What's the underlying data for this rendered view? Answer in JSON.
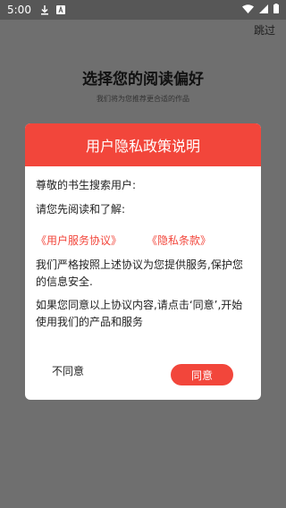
{
  "status_bar": {
    "time": "5:00",
    "icons": [
      "download-icon",
      "notification-a-icon",
      "wifi-icon",
      "signal-icon",
      "battery-icon"
    ]
  },
  "page": {
    "skip_label": "跳过",
    "title": "选择您的阅读偏好",
    "subtitle": "我们将为您推荐更合适的作品"
  },
  "dialog": {
    "title": "用户隐私政策说明",
    "greeting": "尊敬的书生搜索用户:",
    "intro": "请您先阅读和了解:",
    "link_service": "《用户服务协议》",
    "link_privacy": "《隐私条款》",
    "paragraph1": "我们严格按照上述协议为您提供服务,保护您的信息安全.",
    "paragraph2": "如果您同意以上协议内容,请点击‘同意’,开始使用我们的产品和服务",
    "disagree_label": "不同意",
    "agree_label": "同意"
  },
  "colors": {
    "accent": "#f2463b",
    "overlay": "#6f6f6f",
    "status_bar": "#575757"
  }
}
